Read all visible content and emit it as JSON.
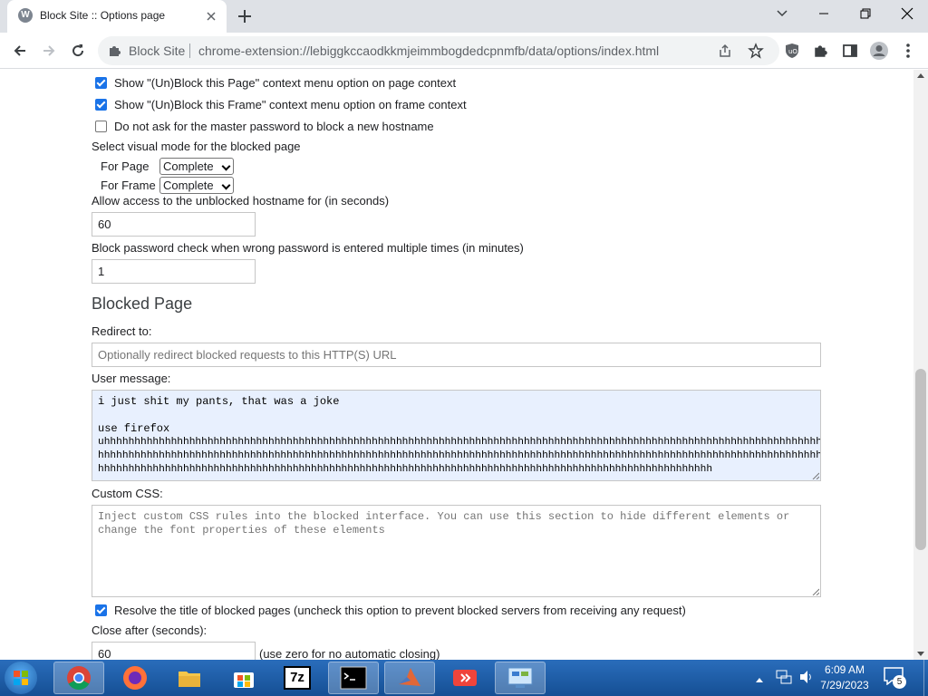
{
  "browser": {
    "tab_title": "Block Site :: Options page",
    "tab_favicon_letter": "W",
    "site_chip": "Block Site",
    "url": "chrome-extension://lebiggkccaodkkmjeimmbogdedcpnmfb/data/options/index.html"
  },
  "options": {
    "ctx_page_label": "Show \"(Un)Block this Page\" context menu option on page context",
    "ctx_page_checked": true,
    "ctx_frame_label": "Show \"(Un)Block this Frame\" context menu option on frame context",
    "ctx_frame_checked": true,
    "no_master_label": "Do not ask for the master password to block a new hostname",
    "no_master_checked": false,
    "visual_mode_label": "Select visual mode for the blocked page",
    "for_page_label": "For Page",
    "for_page_value": "Complete",
    "for_frame_label": "For Frame",
    "for_frame_value": "Complete",
    "allow_access_label": "Allow access to the unblocked hostname for (in seconds)",
    "allow_access_value": "60",
    "pwd_check_label": "Block password check when wrong password is entered multiple times (in minutes)",
    "pwd_check_value": "1"
  },
  "blocked_page": {
    "heading": "Blocked Page",
    "redirect_label": "Redirect to:",
    "redirect_placeholder": "Optionally redirect blocked requests to this HTTP(S) URL",
    "user_message_label": "User message:",
    "user_message_line1": "i just shit my pants, that was a joke",
    "user_message_line3": "use firefox",
    "user_message_line4": "uhhhhhhhhhhhhhhhhhhhhhhhhhhhhhhhhhhhhhhhhhhhhhhhhhhhhhhhhhhhhhhhhhhhhhhhhhhhhhhhhhhhhhhhhhhhhhhhhhhhhhhhhhhhhhhhhhhhhhhhhhhhhhhhhhhhhhh",
    "user_message_line5": "hhhhhhhhhhhhhhhhhhhhhhhhhhhhhhhhhhhhhhhhhhhhhhhhhhhhhhhhhhhhhhhhhhhhhhhhhhhhhhhhhhhhhhhhhhhhhhhhhhhhhhhhhhhhhhhhhhhhhhhhhhhhhhhhhhhhhhh",
    "user_message_line6": "hhhhhhhhhhhhhhhhhhhhhhhhhhhhhhhhhhhhhhhhhhhhhhhhhhhhhhhhhhhhhhhhhhhhhhhhhhhhhhhhhhhhhhhhhhhhhhhhhhhhh",
    "custom_css_label": "Custom CSS:",
    "custom_css_placeholder_l1": "Inject custom CSS rules into the blocked interface. You can use this section to hide different elements or",
    "custom_css_placeholder_l2": "change the font properties of these elements",
    "resolve_title_label": "Resolve the title of blocked pages (uncheck this option to prevent blocked servers from receiving any request)",
    "resolve_title_checked": true,
    "close_after_label": "Close after (seconds):",
    "close_after_value": "60",
    "close_after_hint": "(use zero for no automatic closing)"
  },
  "taskbar": {
    "items": [
      "chrome",
      "firefox",
      "file-explorer",
      "store",
      "7zip",
      "command-prompt",
      "matlab",
      "anydesk",
      "control-panel"
    ],
    "seven_zip_text": "7z",
    "time": "6:09 AM",
    "date": "7/29/2023",
    "notification_count": "5"
  },
  "colors": {
    "accent": "#1a73e8",
    "textarea_bg": "#e8f0fe",
    "taskbar": "#1d5fa8"
  }
}
